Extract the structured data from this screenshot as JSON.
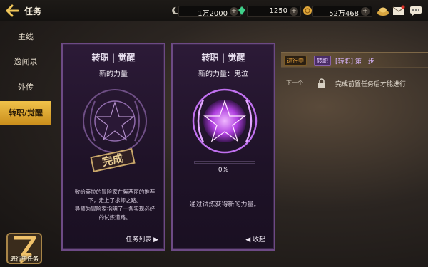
{
  "header": {
    "title": "任务",
    "resources": [
      {
        "icon": "moon-icon",
        "value": "1万2000",
        "color": "#c9c3b6"
      },
      {
        "icon": "green-crystal-icon",
        "value": "1250",
        "color": "#3fd08a"
      },
      {
        "icon": "gold-coin-icon",
        "value": "52万468",
        "color": "#e2a83a"
      }
    ],
    "icons": [
      "gold-ingot-icon",
      "mail-icon",
      "chat-icon"
    ]
  },
  "sidebar": {
    "items": [
      {
        "label": "主线",
        "active": false
      },
      {
        "label": "逸闻录",
        "active": false
      },
      {
        "label": "外传",
        "active": false
      },
      {
        "label": "转职/觉醒",
        "active": true
      }
    ]
  },
  "cards": [
    {
      "title": "转职 | 觉醒",
      "subtitle": "新的力量",
      "stamp": "完成",
      "desc_line1": "致给莱拉的冒险家在紫西丽的推荐",
      "desc_line2": "下，走上了求师之路。",
      "desc_line3": "导师为冒险家指明了一条实现必经",
      "desc_line4": "的试炼道路。",
      "footer": "任务列表",
      "footer_icon": "chevron-right-icon"
    },
    {
      "title": "转职 | 觉醒",
      "subtitle": "新的力量：鬼泣",
      "progress": 0,
      "progress_label": "0%",
      "desc": "通过试炼获得新的力量。",
      "footer": "收起",
      "footer_icon": "chevron-left-icon"
    }
  ],
  "quests": {
    "current": {
      "status": "进行中",
      "type": "转职",
      "title": "[转职] 第一步"
    },
    "next": {
      "status": "下一个",
      "text": "完成前置任务后才能进行"
    }
  },
  "bottom_button": {
    "label": "进行中任务"
  }
}
